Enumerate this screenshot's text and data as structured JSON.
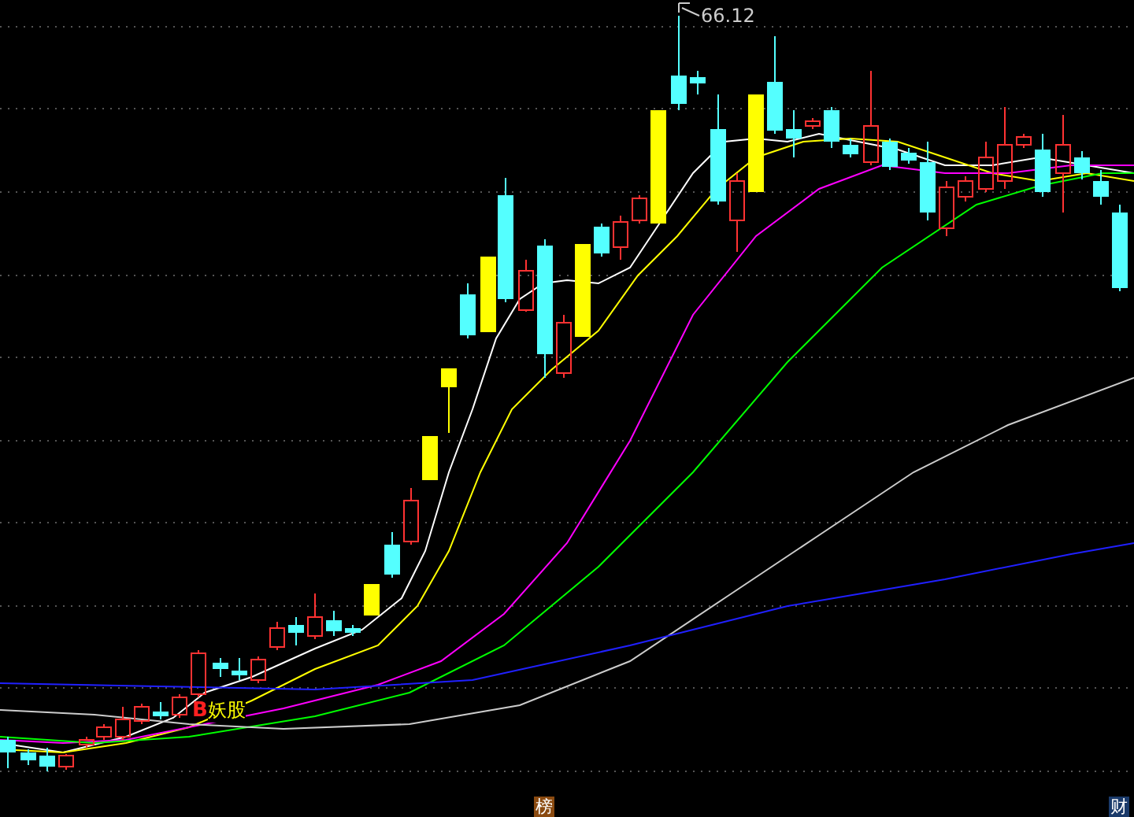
{
  "chart": {
    "high_label": "66.12",
    "signal_mark": "B",
    "signal_label": "妖股"
  },
  "bottom_tabs": [
    {
      "label": "榜",
      "kind": "rank"
    },
    {
      "label": "财",
      "kind": "finance"
    }
  ]
}
